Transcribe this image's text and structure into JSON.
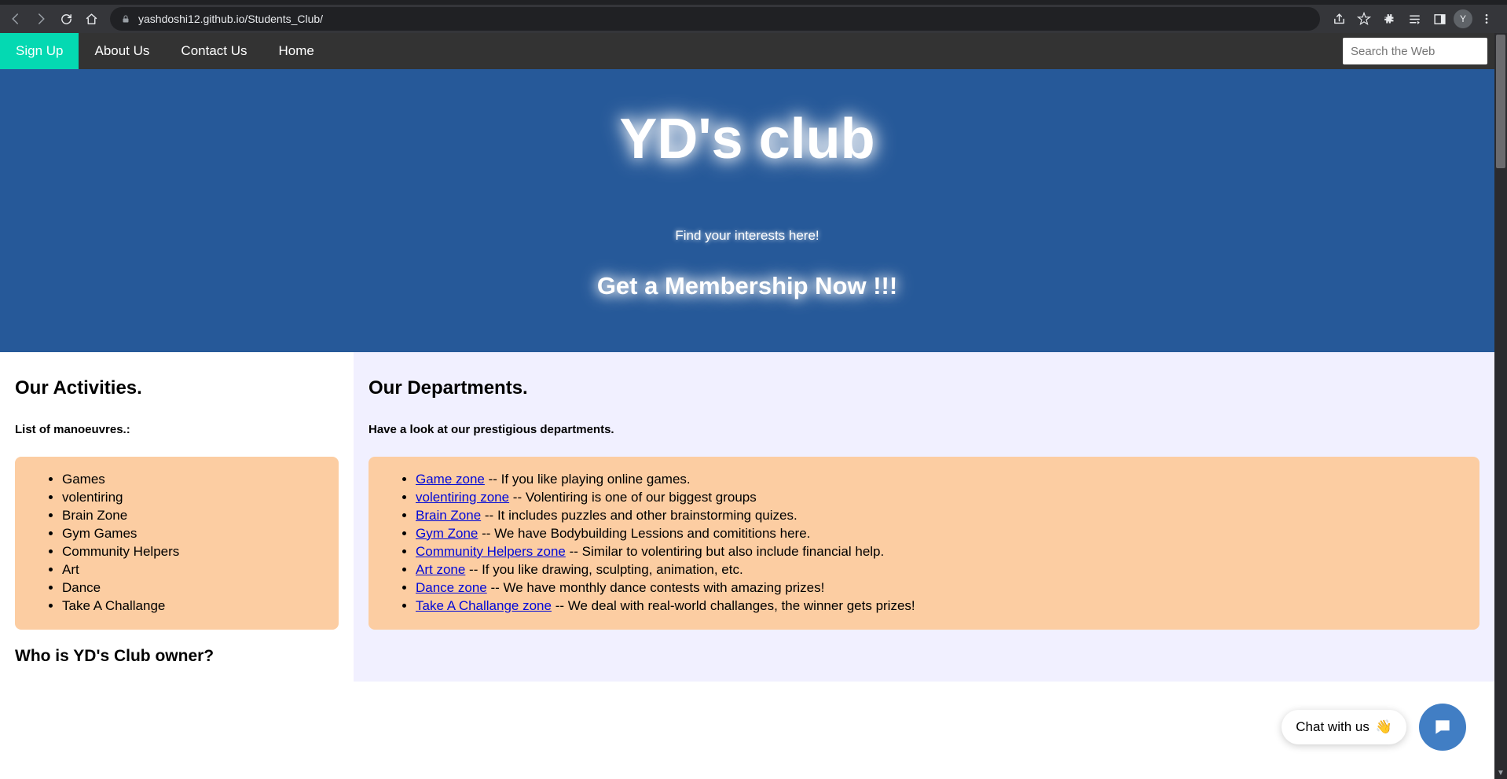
{
  "browser": {
    "url": "yashdoshi12.github.io/Students_Club/",
    "avatar_initial": "Y"
  },
  "nav": {
    "signup": "Sign Up",
    "about": "About Us",
    "contact": "Contact Us",
    "home": "Home",
    "search_placeholder": "Search the Web"
  },
  "hero": {
    "title": "YD's club",
    "tagline": "Find your interests here!",
    "cta": "Get a Membership Now !!!"
  },
  "activities": {
    "heading": "Our Activities.",
    "sub": "List of manoeuvres.:",
    "items": [
      "Games",
      "volentiring",
      "Brain Zone",
      "Gym Games",
      "Community Helpers",
      "Art",
      "Dance",
      "Take A Challange"
    ],
    "owner_q": "Who is YD's Club owner?"
  },
  "departments": {
    "heading": "Our Departments.",
    "sub": "Have a look at our prestigious departments.",
    "items": [
      {
        "link": "Game zone",
        "desc": " -- If you like playing online games."
      },
      {
        "link": "volentiring zone",
        "desc": " -- Volentiring is one of our biggest groups"
      },
      {
        "link": "Brain Zone",
        "desc": " -- It includes puzzles and other brainstorming quizes."
      },
      {
        "link": "Gym Zone",
        "desc": " -- We have Bodybuilding Lessions and comititions here."
      },
      {
        "link": "Community Helpers zone",
        "desc": " -- Similar to volentiring but also include financial help."
      },
      {
        "link": "Art zone",
        "desc": " -- If you like drawing, sculpting, animation, etc."
      },
      {
        "link": "Dance zone",
        "desc": " -- We have monthly dance contests with amazing prizes!"
      },
      {
        "link": "Take A Challange zone",
        "desc": " -- We deal with real-world challanges, the winner gets prizes!"
      }
    ]
  },
  "chat": {
    "label": "Chat with us",
    "emoji": "👋"
  }
}
